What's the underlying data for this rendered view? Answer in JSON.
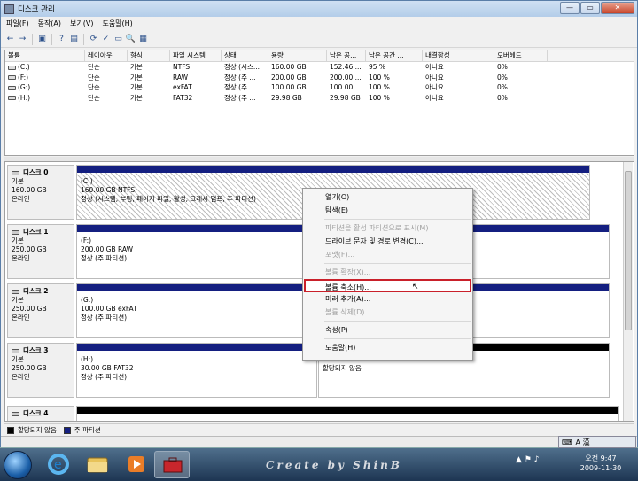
{
  "window": {
    "title": "디스크 관리"
  },
  "menu": [
    "파일(F)",
    "동작(A)",
    "보기(V)",
    "도움말(H)"
  ],
  "toolbar": [
    "←",
    "→",
    "▣",
    "?",
    "▤",
    "⟳",
    "✓",
    "▭",
    "🔍",
    "▦"
  ],
  "volume_list": {
    "columns": [
      "볼륨",
      "레이아웃",
      "형식",
      "파일 시스템",
      "상태",
      "용량",
      "남은 공...",
      "남은 공간 ...",
      "내결함성",
      "오버헤드"
    ],
    "rows": [
      [
        "(C:)",
        "단순",
        "기본",
        "NTFS",
        "정상 (시스...",
        "160.00 GB",
        "152.46 ...",
        "95 %",
        "아니요",
        "0%"
      ],
      [
        "(F:)",
        "단순",
        "기본",
        "RAW",
        "정상 (주 ...",
        "200.00 GB",
        "200.00 ...",
        "100 %",
        "아니요",
        "0%"
      ],
      [
        "(G:)",
        "단순",
        "기본",
        "exFAT",
        "정상 (주 ...",
        "100.00 GB",
        "100.00 ...",
        "100 %",
        "아니요",
        "0%"
      ],
      [
        "(H:)",
        "단순",
        "기본",
        "FAT32",
        "정상 (주 ...",
        "29.98 GB",
        "29.98 GB",
        "100 %",
        "아니요",
        "0%"
      ]
    ]
  },
  "disks": [
    {
      "name": "디스크 0",
      "type": "기본",
      "size": "160.00 GB",
      "status": "온라인",
      "partitions": [
        {
          "line1": "(C:)",
          "line2": "160.00 GB NTFS",
          "line3": "정상 (시스템, 부팅, 페이지 파일, 활성, 크래시 덤프, 주 파티션)"
        }
      ]
    },
    {
      "name": "디스크 1",
      "type": "기본",
      "size": "250.00 GB",
      "status": "온라인",
      "partitions": [
        {
          "line1": "(F:)",
          "line2": "200.00 GB RAW",
          "line3": "정상 (주 파티션)"
        }
      ]
    },
    {
      "name": "디스크 2",
      "type": "기본",
      "size": "250.00 GB",
      "status": "온라인",
      "partitions": [
        {
          "line1": "(G:)",
          "line2": "100.00 GB exFAT",
          "line3": "정상 (주 파티션)"
        }
      ]
    },
    {
      "name": "디스크 3",
      "type": "기본",
      "size": "250.00 GB",
      "status": "온라인",
      "partitions": [
        {
          "line1": "(H:)",
          "line2": "30.00 GB FAT32",
          "line3": "정상 (주 파티션)"
        },
        {
          "line1": "",
          "line2": "220.00 GB",
          "line3": "할당되지 않음"
        }
      ]
    },
    {
      "name": "디스크 4",
      "type": "",
      "size": "",
      "status": "",
      "partitions": []
    }
  ],
  "legend": {
    "unallocated": "할당되지 않음",
    "primary": "주 파티션",
    "unallocated_color": "#000000",
    "primary_color": "#141f80"
  },
  "context_menu": {
    "items": [
      {
        "label": "열기(O)",
        "disabled": false
      },
      {
        "label": "탐색(E)",
        "disabled": false
      },
      {
        "label": "파티션을 활성 파티션으로 표시(M)",
        "disabled": true
      },
      {
        "label": "드라이브 문자 및 경로 변경(C)...",
        "disabled": false
      },
      {
        "label": "포맷(F)...",
        "disabled": true
      },
      {
        "label": "볼륨 확장(X)...",
        "disabled": true
      },
      {
        "label": "볼륨 축소(H)...",
        "disabled": false,
        "highlighted": true
      },
      {
        "label": "미러 추가(A)...",
        "disabled": false
      },
      {
        "label": "볼륨 삭제(D)...",
        "disabled": true
      },
      {
        "label": "속성(P)",
        "disabled": false
      },
      {
        "label": "도움말(H)",
        "disabled": false
      }
    ]
  },
  "taskbar": {
    "credit": "Create by ShinB",
    "time": "오전 9:47",
    "date": "2009-11-30",
    "lang": "A 漢"
  }
}
